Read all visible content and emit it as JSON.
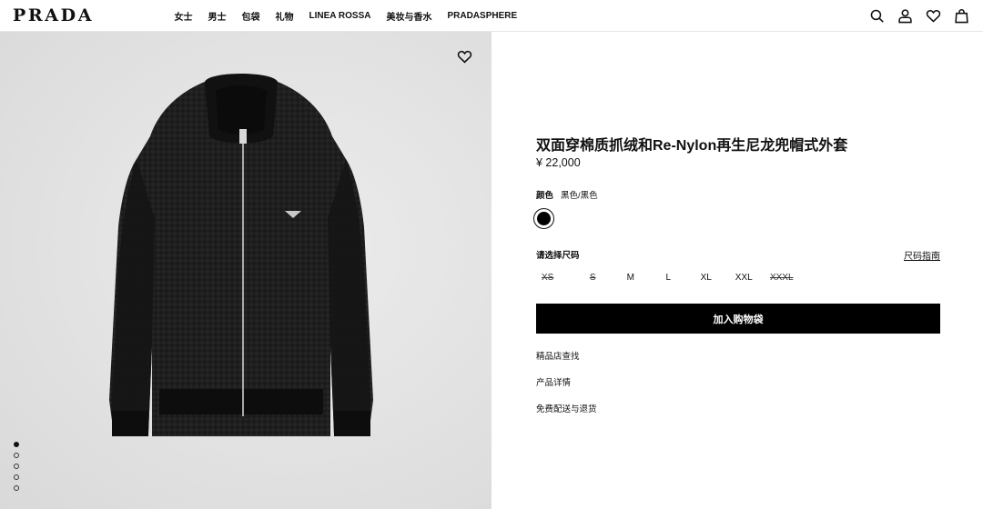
{
  "brand": {
    "logo_text": "PRADA"
  },
  "nav": {
    "items": [
      {
        "label": "女士"
      },
      {
        "label": "男士"
      },
      {
        "label": "包袋"
      },
      {
        "label": "礼物"
      },
      {
        "label": "LINEA ROSSA"
      },
      {
        "label": "美妆与香水"
      },
      {
        "label": "PRADASPHERE"
      }
    ]
  },
  "header_icons": [
    "search-icon",
    "account-icon",
    "wishlist-icon",
    "bag-icon"
  ],
  "gallery": {
    "image_count": 5,
    "active_index": 0
  },
  "product": {
    "title": "双面穿棉质抓绒和Re-Nylon再生尼龙兜帽式外套",
    "price": "¥ 22,000",
    "color_label": "颜色",
    "color_value": "黑色/黑色",
    "swatch_color": "#000000",
    "size_label": "请选择尺码",
    "size_guide": "尺码指南",
    "sizes": [
      {
        "label": "XS",
        "available": false
      },
      {
        "label": "S",
        "available": false
      },
      {
        "label": "M",
        "available": true
      },
      {
        "label": "L",
        "available": true
      },
      {
        "label": "XL",
        "available": true
      },
      {
        "label": "XXL",
        "available": true
      },
      {
        "label": "XXXL",
        "available": false
      }
    ],
    "add_to_bag": "加入购物袋",
    "links": [
      {
        "label": "精品店查找"
      },
      {
        "label": "产品详情"
      },
      {
        "label": "免费配送与退货"
      }
    ]
  }
}
